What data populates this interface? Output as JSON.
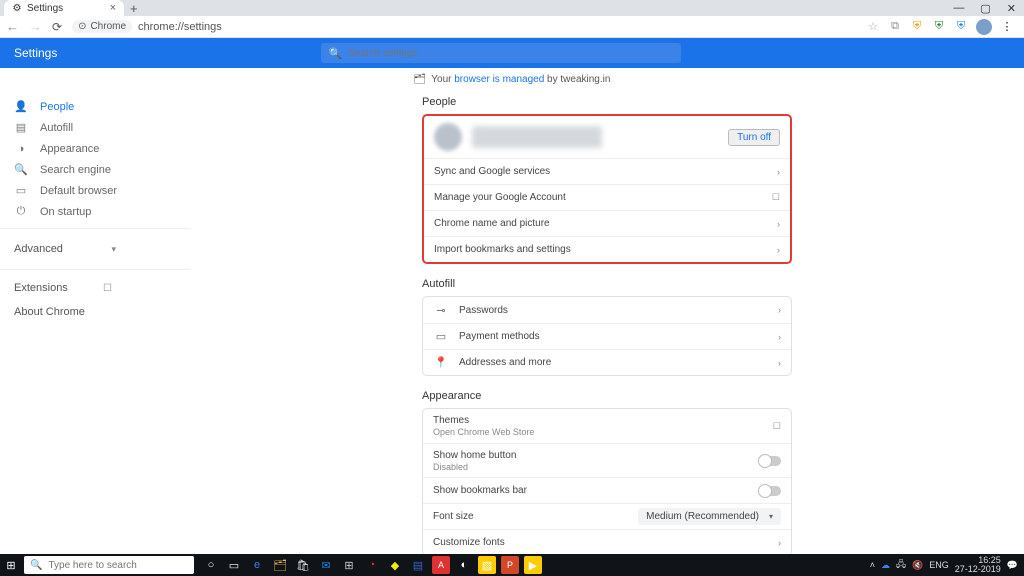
{
  "tab": {
    "title": "Settings"
  },
  "window_controls": {
    "min": "—",
    "max": "▢",
    "close": "✕"
  },
  "url": {
    "chip_label": "Chrome",
    "path": "chrome://settings"
  },
  "header": {
    "title": "Settings"
  },
  "search": {
    "placeholder": "Search settings"
  },
  "managed": {
    "prefix": "Your ",
    "link": "browser is managed",
    "suffix": " by tweaking.in"
  },
  "sidebar": {
    "items": [
      {
        "icon": "👤",
        "label": "People"
      },
      {
        "icon": "▤",
        "label": "Autofill"
      },
      {
        "icon": "◑",
        "label": "Appearance"
      },
      {
        "icon": "🔍",
        "label": "Search engine"
      },
      {
        "icon": "▭",
        "label": "Default browser"
      },
      {
        "icon": "⏻",
        "label": "On startup"
      }
    ],
    "advanced": "Advanced",
    "extensions": "Extensions",
    "about": "About Chrome"
  },
  "people": {
    "title": "People",
    "turn_off": "Turn off",
    "rows": [
      "Sync and Google services",
      "Manage your Google Account",
      "Chrome name and picture",
      "Import bookmarks and settings"
    ]
  },
  "autofill": {
    "title": "Autofill",
    "rows": [
      {
        "icon": "⊸",
        "label": "Passwords"
      },
      {
        "icon": "▭",
        "label": "Payment methods"
      },
      {
        "icon": "📍",
        "label": "Addresses and more"
      }
    ]
  },
  "appearance": {
    "title": "Appearance",
    "themes": {
      "label": "Themes",
      "sub": "Open Chrome Web Store"
    },
    "home": {
      "label": "Show home button",
      "sub": "Disabled"
    },
    "bookmarks": "Show bookmarks bar",
    "fontsize": {
      "label": "Font size",
      "value": "Medium (Recommended)"
    },
    "customize": "Customize fonts"
  },
  "taskbar": {
    "search_placeholder": "Type here to search",
    "lang": "ENG",
    "time": "16:25",
    "date": "27-12-2019"
  }
}
